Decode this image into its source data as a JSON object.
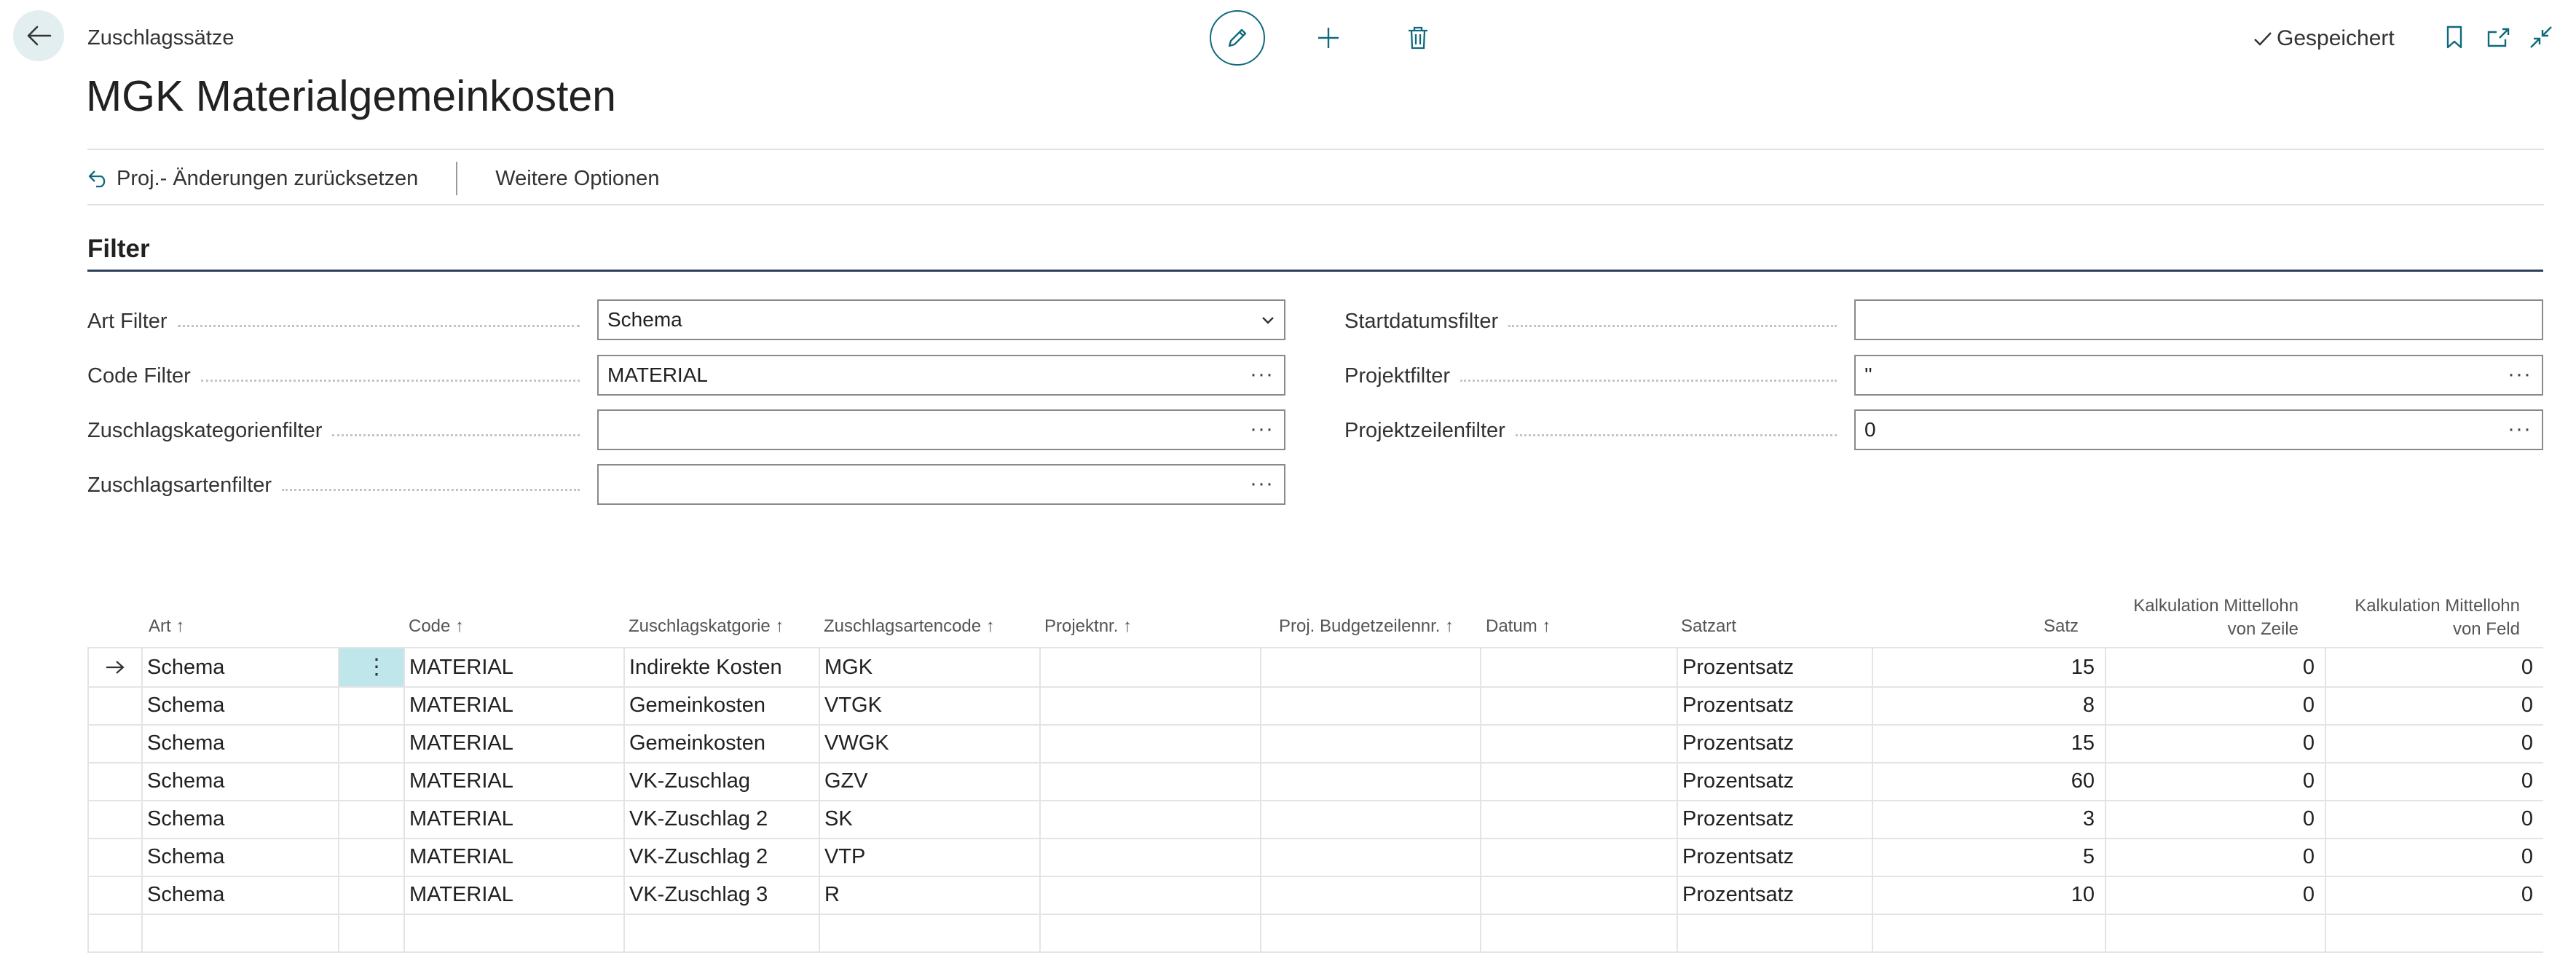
{
  "header": {
    "breadcrumb": "Zuschlagssätze",
    "title": "MGK Materialgemeinkosten",
    "status": "Gespeichert"
  },
  "actions": {
    "reset_label": "Proj.- Änderungen zurücksetzen",
    "more_label": "Weitere Optionen"
  },
  "filter": {
    "title": "Filter",
    "art": {
      "label": "Art Filter",
      "value": "Schema"
    },
    "code": {
      "label": "Code Filter",
      "value": "MATERIAL"
    },
    "kategorie": {
      "label": "Zuschlagskategorienfilter",
      "value": ""
    },
    "arten": {
      "label": "Zuschlagsartenfilter",
      "value": ""
    },
    "startdatum": {
      "label": "Startdatumsfilter",
      "value": ""
    },
    "projekt": {
      "label": "Projektfilter",
      "value": "''"
    },
    "projektzeilen": {
      "label": "Projektzeilenfilter",
      "value": "0"
    }
  },
  "table": {
    "columns": {
      "art": "Art",
      "code": "Code",
      "kategorie": "Zuschlagskatgorie",
      "artencode": "Zuschlagsartencode",
      "projektnr": "Projektnr.",
      "budget": "Proj. Budgetzeilennr.",
      "datum": "Datum",
      "satzart": "Satzart",
      "satz": "Satz",
      "kalk_zeile_1": "Kalkulation Mittellohn",
      "kalk_zeile_2": "von Zeile",
      "kalk_feld_1": "Kalkulation Mittellohn",
      "kalk_feld_2": "von Feld"
    },
    "rows": [
      {
        "art": "Schema",
        "code": "MATERIAL",
        "kategorie": "Indirekte Kosten",
        "artencode": "MGK",
        "projektnr": "",
        "budget": "",
        "datum": "",
        "satzart": "Prozentsatz",
        "satz": "15",
        "kalk_zeile": "0",
        "kalk_feld": "0"
      },
      {
        "art": "Schema",
        "code": "MATERIAL",
        "kategorie": "Gemeinkosten",
        "artencode": "VTGK",
        "projektnr": "",
        "budget": "",
        "datum": "",
        "satzart": "Prozentsatz",
        "satz": "8",
        "kalk_zeile": "0",
        "kalk_feld": "0"
      },
      {
        "art": "Schema",
        "code": "MATERIAL",
        "kategorie": "Gemeinkosten",
        "artencode": "VWGK",
        "projektnr": "",
        "budget": "",
        "datum": "",
        "satzart": "Prozentsatz",
        "satz": "15",
        "kalk_zeile": "0",
        "kalk_feld": "0"
      },
      {
        "art": "Schema",
        "code": "MATERIAL",
        "kategorie": "VK-Zuschlag",
        "artencode": "GZV",
        "projektnr": "",
        "budget": "",
        "datum": "",
        "satzart": "Prozentsatz",
        "satz": "60",
        "kalk_zeile": "0",
        "kalk_feld": "0"
      },
      {
        "art": "Schema",
        "code": "MATERIAL",
        "kategorie": "VK-Zuschlag 2",
        "artencode": "SK",
        "projektnr": "",
        "budget": "",
        "datum": "",
        "satzart": "Prozentsatz",
        "satz": "3",
        "kalk_zeile": "0",
        "kalk_feld": "0"
      },
      {
        "art": "Schema",
        "code": "MATERIAL",
        "kategorie": "VK-Zuschlag 2",
        "artencode": "VTP",
        "projektnr": "",
        "budget": "",
        "datum": "",
        "satzart": "Prozentsatz",
        "satz": "5",
        "kalk_zeile": "0",
        "kalk_feld": "0"
      },
      {
        "art": "Schema",
        "code": "MATERIAL",
        "kategorie": "VK-Zuschlag 3",
        "artencode": "R",
        "projektnr": "",
        "budget": "",
        "datum": "",
        "satzart": "Prozentsatz",
        "satz": "10",
        "kalk_zeile": "0",
        "kalk_feld": "0"
      },
      {
        "art": "",
        "code": "",
        "kategorie": "",
        "artencode": "",
        "projektnr": "",
        "budget": "",
        "datum": "",
        "satzart": "",
        "satz": "",
        "kalk_zeile": "",
        "kalk_feld": ""
      }
    ]
  },
  "colors": {
    "accent": "#0f6a7c",
    "selected_cell": "#bfe6ea"
  }
}
